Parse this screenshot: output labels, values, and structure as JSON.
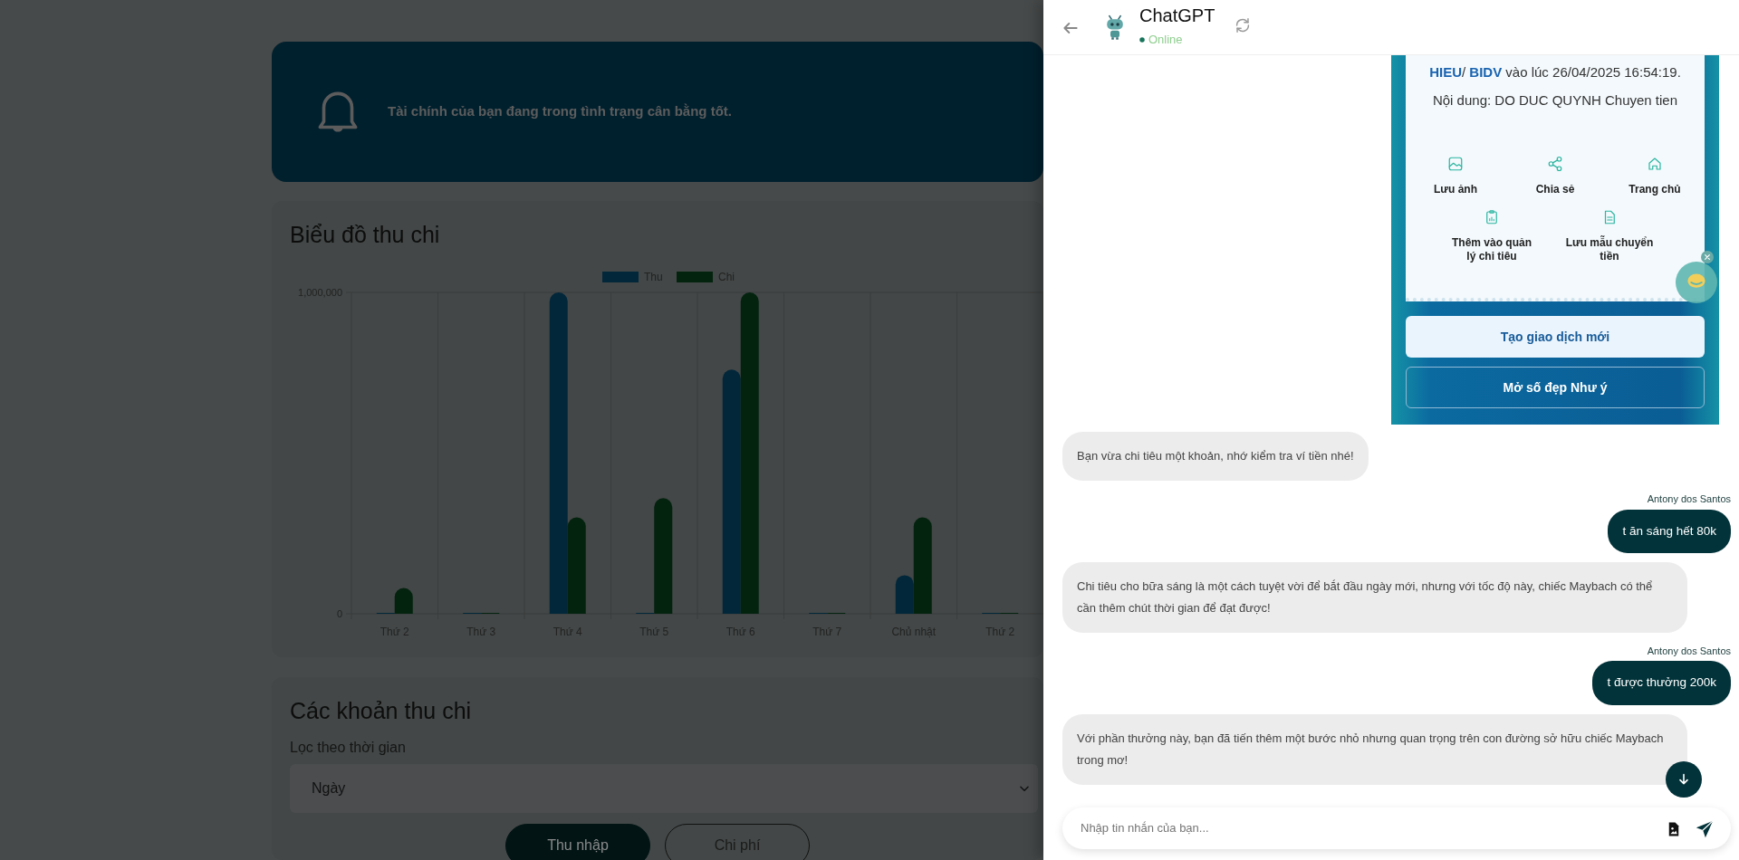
{
  "page": {
    "banner": {
      "message": "Tài chính của bạn đang trong tình trạng cân bằng tốt."
    },
    "chart_card": {
      "title": "Biểu đồ thu chi",
      "chart_data": {
        "type": "bar",
        "categories": [
          "Thứ 2",
          "Thứ 3",
          "Thứ 4",
          "Thứ 5",
          "Thứ 6",
          "Thứ 7",
          "Chủ nhật",
          "Thứ 2"
        ],
        "series": [
          {
            "name": "Thu",
            "color": "#02273a",
            "values": [
              0,
              0,
              1000000,
              0,
              760000,
              0,
              120000,
              0
            ]
          },
          {
            "name": "Chi",
            "color": "#03230f",
            "values": [
              80000,
              0,
              300000,
              360000,
              1000000,
              0,
              300000,
              0
            ]
          }
        ],
        "legend": "top",
        "ylim": [
          0,
          1000000
        ],
        "yticks": [
          {
            "value": 0,
            "label": "0"
          },
          {
            "value": 1000000,
            "label": "1,000,000"
          }
        ]
      }
    },
    "transactions": {
      "title": "Các khoản thu chi",
      "filter_label": "Lọc theo thời gian",
      "filter": {
        "value": "Ngày"
      },
      "type_tabs": [
        {
          "label": "Thu nhập",
          "selected": true
        },
        {
          "label": "Chi phí",
          "selected": false
        }
      ]
    }
  },
  "chat": {
    "header": {
      "title": "ChatGPT",
      "status": "Online"
    },
    "messages": [
      {
        "kind": "image",
        "receipt": {
          "lines": [
            [
              {
                "text": "HIEU",
                "highlight": true
              },
              {
                "text": "/ ",
                "highlight": false
              },
              {
                "text": "BIDV",
                "highlight": true
              },
              {
                "text": " vào lúc 26/04/2025 16:54:19.",
                "highlight": false
              }
            ],
            [
              {
                "text": "Nội dung: DO DUC QUYNH Chuyen tien",
                "highlight": false
              }
            ]
          ],
          "actions": [
            {
              "kind": "photo",
              "label": "Lưu ảnh"
            },
            {
              "kind": "share",
              "label": "Chia sẻ"
            },
            {
              "kind": "home",
              "label": "Trang chủ"
            },
            {
              "kind": "clipboard",
              "label": "Thêm vào quản lý chi tiêu"
            },
            {
              "kind": "document",
              "label": "Lưu mẫu chuyển tiền"
            }
          ],
          "buttons": [
            {
              "kind": "primary",
              "label": "Tạo giao dịch mới"
            },
            {
              "kind": "outline",
              "label": "Mở số đẹp Như ý"
            }
          ]
        }
      },
      {
        "kind": "bot",
        "text": "Bạn vừa chi tiêu một khoản, nhớ kiểm tra ví tiền nhé!"
      },
      {
        "kind": "user",
        "sender": "Antony dos Santos",
        "text": "t ăn sáng hết 80k"
      },
      {
        "kind": "bot",
        "text": "Chi tiêu cho bữa sáng là một cách tuyệt vời để bắt đầu ngày mới, nhưng với tốc độ này, chiếc Maybach có thể cần thêm chút thời gian để đạt được!"
      },
      {
        "kind": "user",
        "sender": "Antony dos Santos",
        "text": "t được thưởng 200k"
      },
      {
        "kind": "bot",
        "text": "Với phần thưởng này, bạn đã tiến thêm một bước nhỏ nhưng quan trọng trên con đường sở hữu chiếc Maybach trong mơ!"
      }
    ],
    "input": {
      "placeholder": "Nhập tin nhắn của bạn..."
    }
  }
}
